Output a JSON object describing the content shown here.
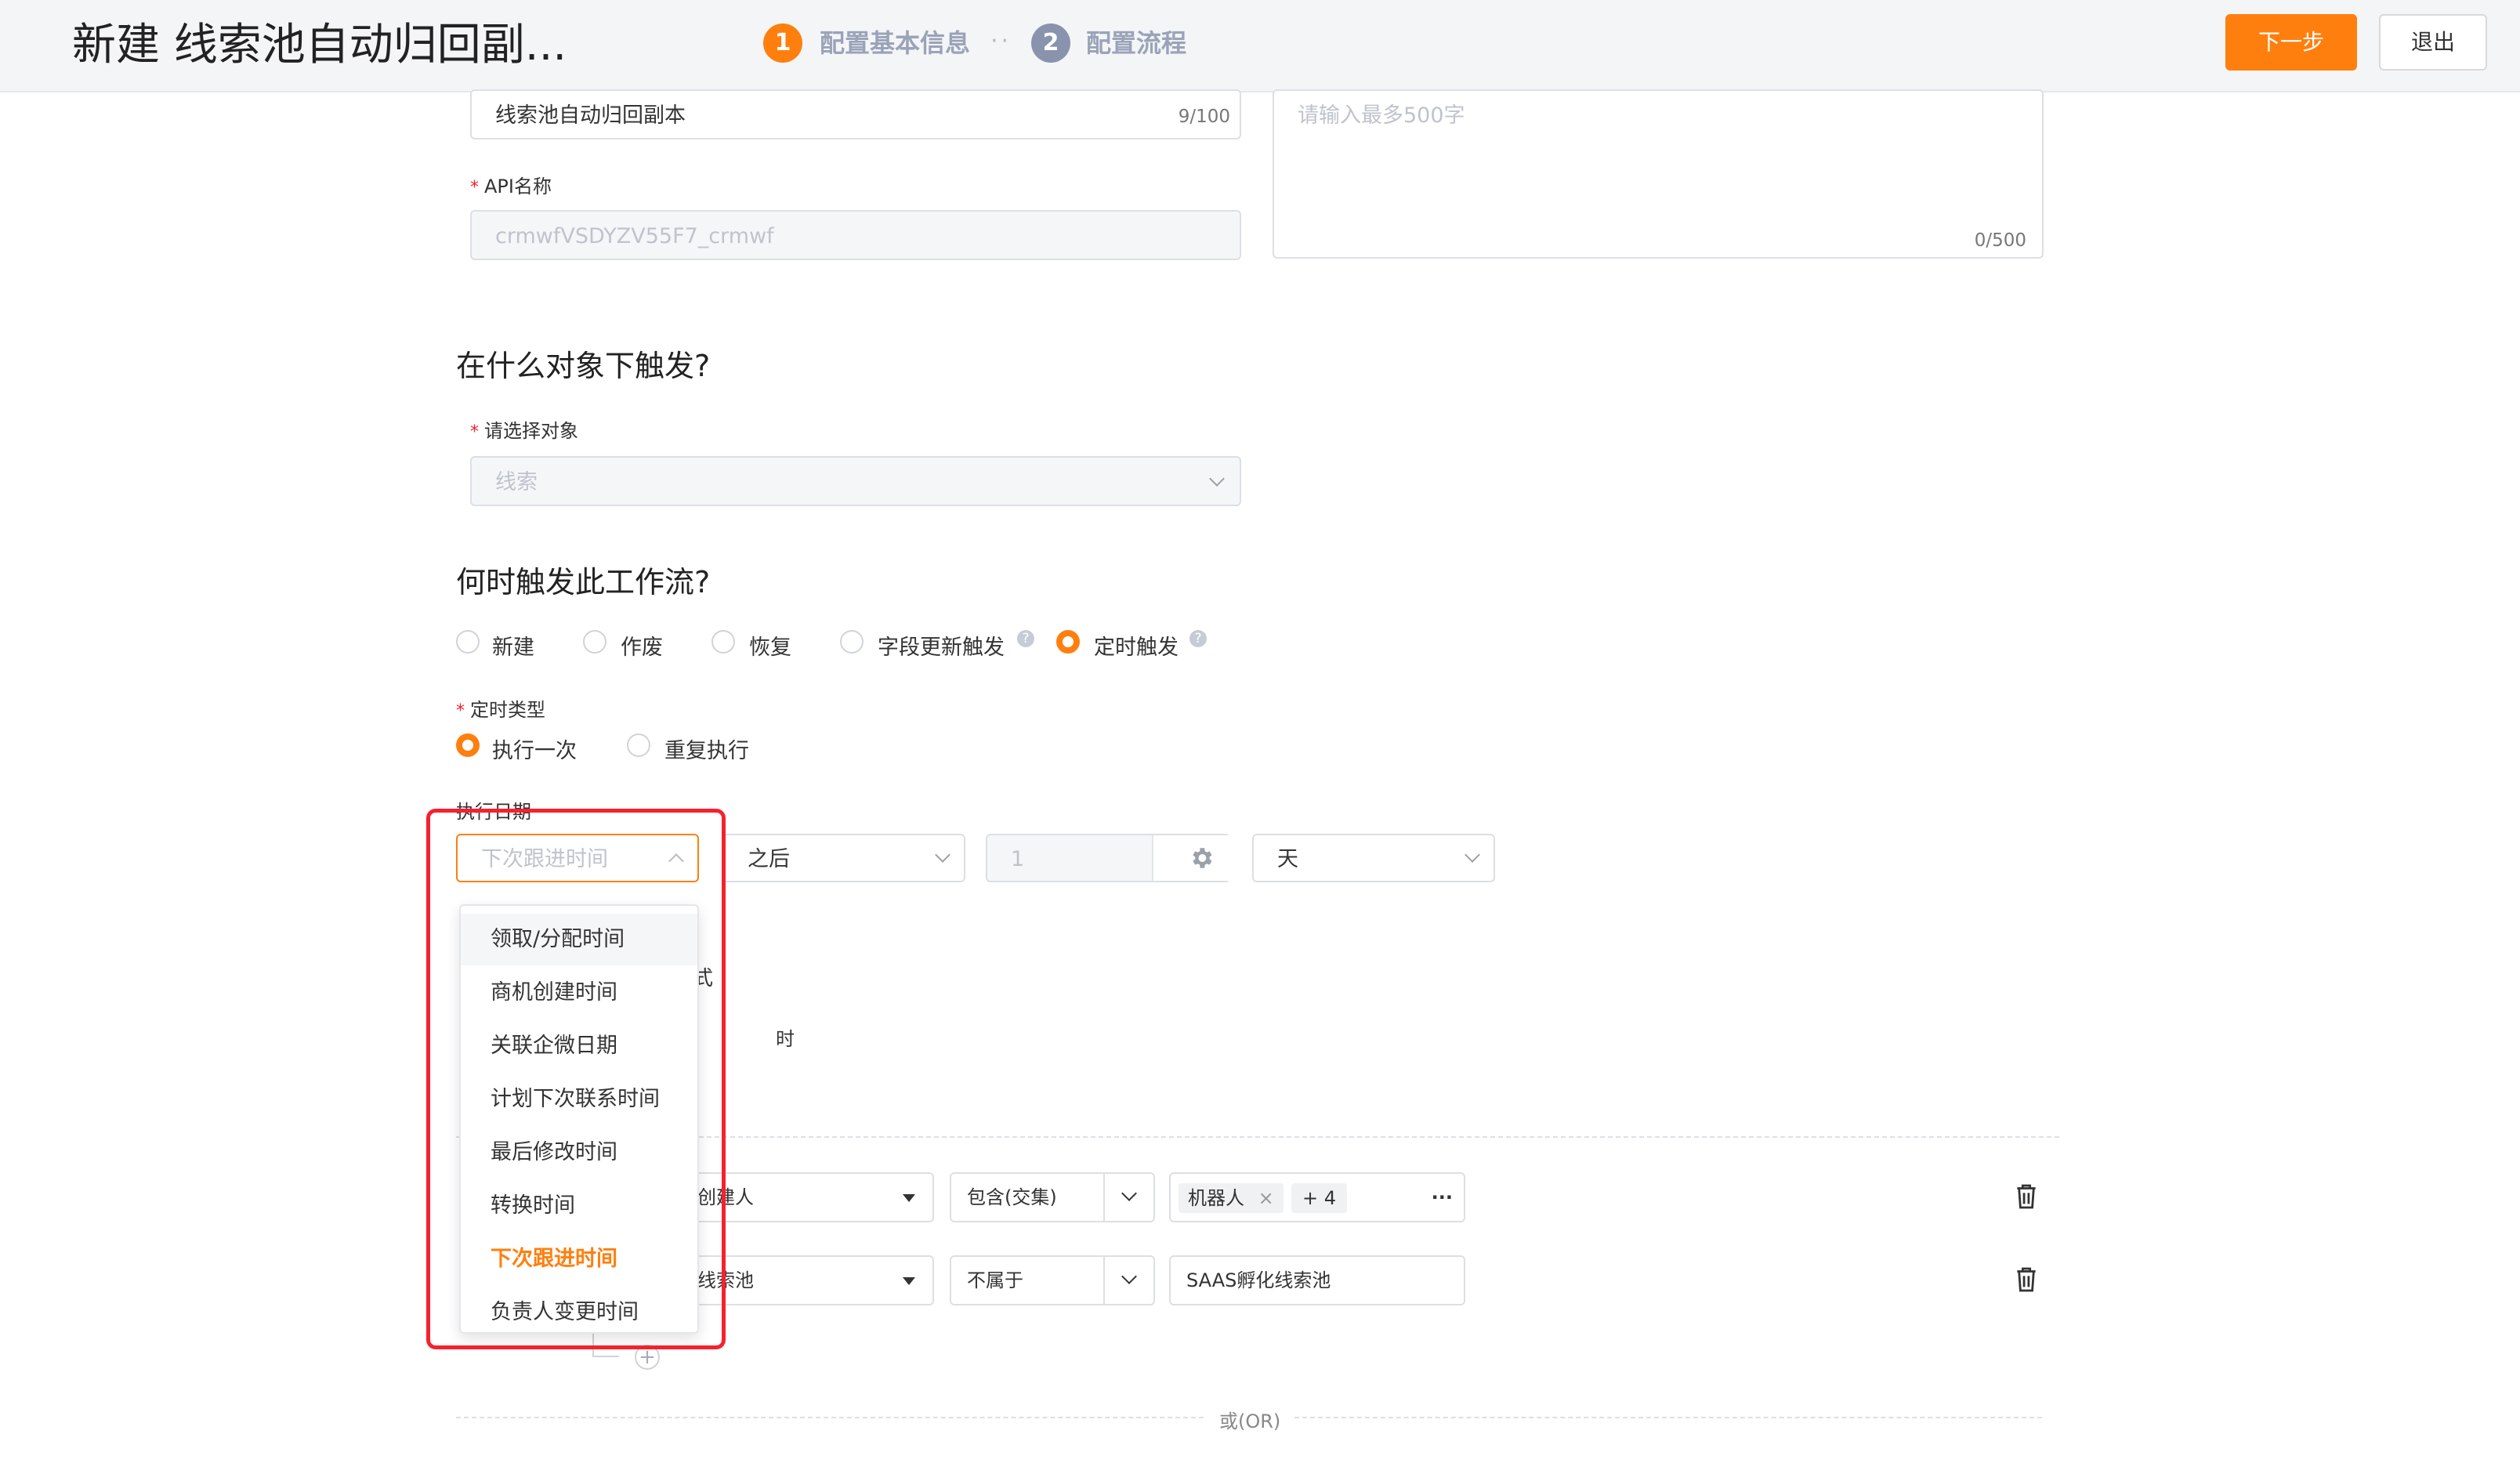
{
  "header": {
    "title": "新建 线索池自动归回副...",
    "steps": [
      {
        "number": "1",
        "label": "配置基本信息",
        "state": "active"
      },
      {
        "number": "2",
        "label": "配置流程",
        "state": "inactive"
      }
    ],
    "step_separator": "··",
    "next_button": "下一步",
    "exit_button": "退出"
  },
  "basic": {
    "name_value": "线索池自动归回副本",
    "name_counter": "9/100",
    "api_label": "API名称",
    "api_value": "crmwfVSDYZV55F7_crmwf",
    "desc_placeholder": "请输入最多500字",
    "desc_counter": "0/500"
  },
  "object_section": {
    "title": "在什么对象下触发?",
    "select_label": "请选择对象",
    "select_value": "线索"
  },
  "trigger_section": {
    "title": "何时触发此工作流?",
    "options": [
      {
        "label": "新建",
        "checked": false
      },
      {
        "label": "作废",
        "checked": false
      },
      {
        "label": "恢复",
        "checked": false
      },
      {
        "label": "字段更新触发",
        "checked": false,
        "help": true
      },
      {
        "label": "定时触发",
        "checked": true,
        "help": true
      }
    ],
    "help_glyph": "?",
    "timer_type_label": "定时类型",
    "timer_types": [
      {
        "label": "执行一次",
        "checked": true
      },
      {
        "label": "重复执行",
        "checked": false
      }
    ],
    "exec_date_label": "执行日期",
    "date_field_placeholder": "下次跟进时间",
    "relation_value": "之后",
    "offset_value": "1",
    "unit_value": "天",
    "partial_text_1": "式",
    "partial_text_2": "时"
  },
  "dropdown": {
    "items": [
      {
        "label": "领取/分配时间",
        "state": "hover"
      },
      {
        "label": "商机创建时间",
        "state": "normal"
      },
      {
        "label": "关联企微日期",
        "state": "normal"
      },
      {
        "label": "计划下次联系时间",
        "state": "normal"
      },
      {
        "label": "最后修改时间",
        "state": "normal"
      },
      {
        "label": "转换时间",
        "state": "normal"
      },
      {
        "label": "下次跟进时间",
        "state": "selected"
      },
      {
        "label": "负责人变更时间",
        "state": "normal"
      }
    ]
  },
  "conditions": {
    "rows": [
      {
        "field": "创建人",
        "operator": "包含(交集)",
        "tag": "机器人",
        "tag_close": "×",
        "more": "+ 4",
        "ellipsis": "···"
      },
      {
        "field": "线索池",
        "operator": "不属于",
        "value": "SAAS孵化线索池"
      }
    ],
    "add_glyph": "+",
    "or_label": "或(OR)"
  },
  "colors": {
    "accent": "#ff7f0e",
    "highlight": "#f5222d",
    "step_inactive": "#8a93ad"
  }
}
